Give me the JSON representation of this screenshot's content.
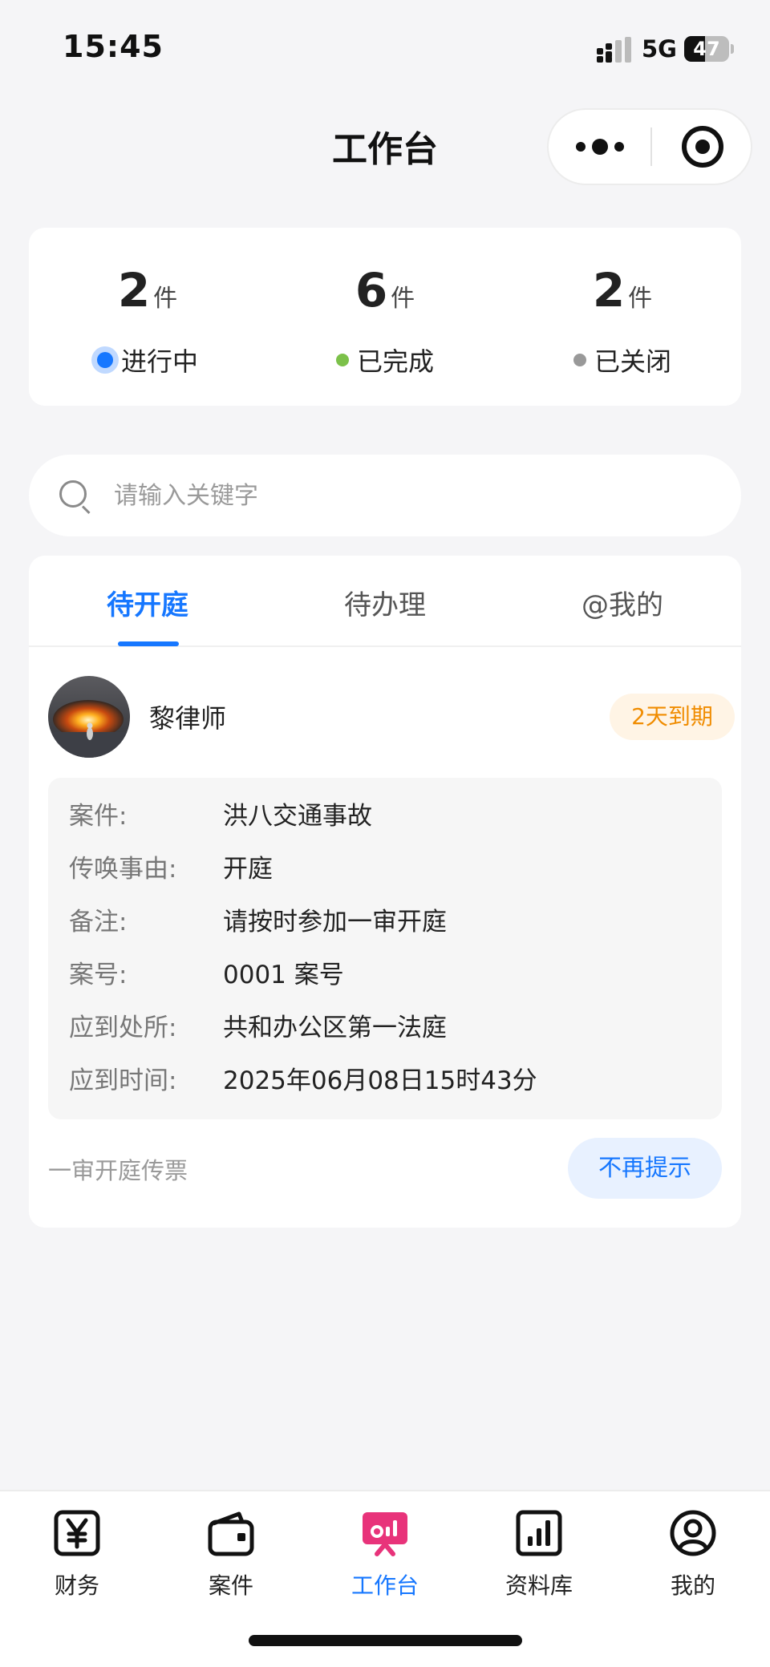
{
  "status_bar": {
    "time": "15:45",
    "network": "5G",
    "battery": "47",
    "battery_level": 0.47
  },
  "header": {
    "title": "工作台"
  },
  "stats": [
    {
      "count": "2",
      "unit": "件",
      "label": "进行中",
      "color": "#1677ff"
    },
    {
      "count": "6",
      "unit": "件",
      "label": "已完成",
      "color": "#7cc14a"
    },
    {
      "count": "2",
      "unit": "件",
      "label": "已关闭",
      "color": "#999999"
    }
  ],
  "search": {
    "placeholder": "请输入关键字"
  },
  "tabs": [
    {
      "label": "待开庭",
      "active": true
    },
    {
      "label": "待办理",
      "active": false
    },
    {
      "label": "@我的",
      "active": false
    }
  ],
  "card": {
    "lawyer_name": "黎律师",
    "due_badge": "2天到期",
    "details": [
      {
        "label": "案件:",
        "value": "洪八交通事故"
      },
      {
        "label": "传唤事由:",
        "value": "开庭"
      },
      {
        "label": "备注:",
        "value": "请按时参加一审开庭"
      },
      {
        "label": "案号:",
        "value": "0001 案号"
      },
      {
        "label": "应到处所:",
        "value": "共和办公区第一法庭"
      },
      {
        "label": "应到时间:",
        "value": "2025年06月08日15时43分"
      }
    ],
    "summon_type": "一审开庭传票",
    "dismiss_label": "不再提示"
  },
  "bottom_nav": [
    {
      "label": "财务",
      "icon": "yen-icon",
      "active": false
    },
    {
      "label": "案件",
      "icon": "wallet-icon",
      "active": false
    },
    {
      "label": "工作台",
      "icon": "workbench-icon",
      "active": true
    },
    {
      "label": "资料库",
      "icon": "bar-chart-icon",
      "active": false
    },
    {
      "label": "我的",
      "icon": "user-icon",
      "active": false
    }
  ],
  "colors": {
    "accent": "#1677ff",
    "active_nav_icon": "#e8337a",
    "warning": "#f08c00"
  }
}
